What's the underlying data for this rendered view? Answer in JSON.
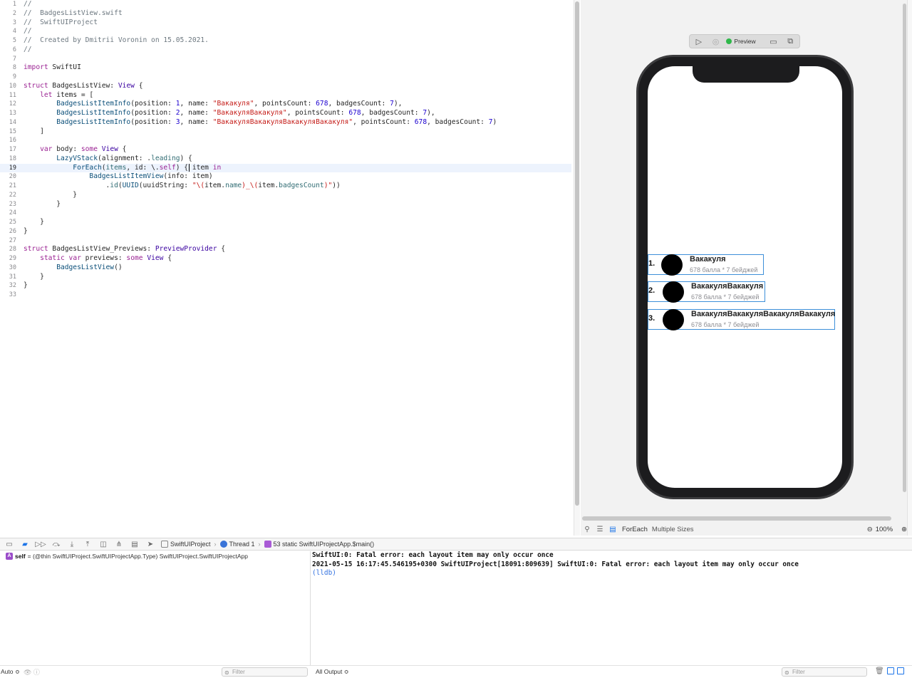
{
  "editor": {
    "current_line": 19,
    "lines": [
      {
        "n": "1",
        "tokens": [
          {
            "t": "//",
            "c": "comment"
          }
        ]
      },
      {
        "n": "2",
        "tokens": [
          {
            "t": "//  BadgesListView.swift",
            "c": "comment"
          }
        ]
      },
      {
        "n": "3",
        "tokens": [
          {
            "t": "//  SwiftUIProject",
            "c": "comment"
          }
        ]
      },
      {
        "n": "4",
        "tokens": [
          {
            "t": "//",
            "c": "comment"
          }
        ]
      },
      {
        "n": "5",
        "tokens": [
          {
            "t": "//  Created by Dmitrii Voronin on 15.05.2021.",
            "c": "comment"
          }
        ]
      },
      {
        "n": "6",
        "tokens": [
          {
            "t": "//",
            "c": "comment"
          }
        ]
      },
      {
        "n": "7",
        "tokens": []
      },
      {
        "n": "8",
        "tokens": [
          {
            "t": "import",
            "c": "keyword"
          },
          {
            "t": " SwiftUI",
            "c": "plain"
          }
        ]
      },
      {
        "n": "9",
        "tokens": []
      },
      {
        "n": "10",
        "tokens": [
          {
            "t": "struct",
            "c": "keyword"
          },
          {
            "t": " BadgesListView: ",
            "c": "plain"
          },
          {
            "t": "View",
            "c": "type"
          },
          {
            "t": " {",
            "c": "plain"
          }
        ]
      },
      {
        "n": "11",
        "tokens": [
          {
            "t": "    ",
            "c": "plain"
          },
          {
            "t": "let",
            "c": "keyword"
          },
          {
            "t": " items = [",
            "c": "plain"
          }
        ]
      },
      {
        "n": "12",
        "tokens": [
          {
            "t": "        BadgesListItemInfo",
            "c": "class"
          },
          {
            "t": "(position: ",
            "c": "plain"
          },
          {
            "t": "1",
            "c": "number"
          },
          {
            "t": ", name: ",
            "c": "plain"
          },
          {
            "t": "\"Вакакуля\"",
            "c": "string"
          },
          {
            "t": ", pointsCount: ",
            "c": "plain"
          },
          {
            "t": "678",
            "c": "number"
          },
          {
            "t": ", badgesCount: ",
            "c": "plain"
          },
          {
            "t": "7",
            "c": "number"
          },
          {
            "t": "),",
            "c": "plain"
          }
        ]
      },
      {
        "n": "13",
        "tokens": [
          {
            "t": "        BadgesListItemInfo",
            "c": "class"
          },
          {
            "t": "(position: ",
            "c": "plain"
          },
          {
            "t": "2",
            "c": "number"
          },
          {
            "t": ", name: ",
            "c": "plain"
          },
          {
            "t": "\"ВакакуляВакакуля\"",
            "c": "string"
          },
          {
            "t": ", pointsCount: ",
            "c": "plain"
          },
          {
            "t": "678",
            "c": "number"
          },
          {
            "t": ", badgesCount: ",
            "c": "plain"
          },
          {
            "t": "7",
            "c": "number"
          },
          {
            "t": "),",
            "c": "plain"
          }
        ]
      },
      {
        "n": "14",
        "tokens": [
          {
            "t": "        BadgesListItemInfo",
            "c": "class"
          },
          {
            "t": "(position: ",
            "c": "plain"
          },
          {
            "t": "3",
            "c": "number"
          },
          {
            "t": ", name: ",
            "c": "plain"
          },
          {
            "t": "\"ВакакуляВакакуляВакакуляВакакуля\"",
            "c": "string"
          },
          {
            "t": ", pointsCount: ",
            "c": "plain"
          },
          {
            "t": "678",
            "c": "number"
          },
          {
            "t": ", badgesCount: ",
            "c": "plain"
          },
          {
            "t": "7",
            "c": "number"
          },
          {
            "t": ")",
            "c": "plain"
          }
        ]
      },
      {
        "n": "15",
        "tokens": [
          {
            "t": "    ]",
            "c": "plain"
          }
        ]
      },
      {
        "n": "16",
        "tokens": []
      },
      {
        "n": "17",
        "tokens": [
          {
            "t": "    ",
            "c": "plain"
          },
          {
            "t": "var",
            "c": "keyword"
          },
          {
            "t": " body: ",
            "c": "plain"
          },
          {
            "t": "some",
            "c": "keyword"
          },
          {
            "t": " ",
            "c": "plain"
          },
          {
            "t": "View",
            "c": "type"
          },
          {
            "t": " {",
            "c": "plain"
          }
        ]
      },
      {
        "n": "18",
        "tokens": [
          {
            "t": "        LazyVStack",
            "c": "class"
          },
          {
            "t": "(alignment: .",
            "c": "plain"
          },
          {
            "t": "leading",
            "c": "func"
          },
          {
            "t": ") {",
            "c": "plain"
          }
        ]
      },
      {
        "n": "19",
        "tokens": [
          {
            "t": "            ForEach",
            "c": "class"
          },
          {
            "t": "(",
            "c": "plain"
          },
          {
            "t": "items",
            "c": "func"
          },
          {
            "t": ", id: \\.",
            "c": "plain"
          },
          {
            "t": "self",
            "c": "keyword"
          },
          {
            "t": ") { item ",
            "c": "plain"
          },
          {
            "t": "in",
            "c": "keyword"
          }
        ]
      },
      {
        "n": "20",
        "tokens": [
          {
            "t": "                BadgesListItemView",
            "c": "class"
          },
          {
            "t": "(info: item)",
            "c": "plain"
          }
        ]
      },
      {
        "n": "21",
        "tokens": [
          {
            "t": "                    .",
            "c": "plain"
          },
          {
            "t": "id",
            "c": "func"
          },
          {
            "t": "(",
            "c": "plain"
          },
          {
            "t": "UUID",
            "c": "class"
          },
          {
            "t": "(uuidString: ",
            "c": "plain"
          },
          {
            "t": "\"\\(",
            "c": "string"
          },
          {
            "t": "item.",
            "c": "plain"
          },
          {
            "t": "name",
            "c": "func"
          },
          {
            "t": ")_\\(",
            "c": "string"
          },
          {
            "t": "item.",
            "c": "plain"
          },
          {
            "t": "badgesCount",
            "c": "func"
          },
          {
            "t": ")\"",
            "c": "string"
          },
          {
            "t": "))",
            "c": "plain"
          }
        ]
      },
      {
        "n": "22",
        "tokens": [
          {
            "t": "            }",
            "c": "plain"
          }
        ]
      },
      {
        "n": "23",
        "tokens": [
          {
            "t": "        }",
            "c": "plain"
          }
        ]
      },
      {
        "n": "24",
        "tokens": []
      },
      {
        "n": "25",
        "tokens": [
          {
            "t": "    }",
            "c": "plain"
          }
        ]
      },
      {
        "n": "26",
        "tokens": [
          {
            "t": "}",
            "c": "plain"
          }
        ]
      },
      {
        "n": "27",
        "tokens": []
      },
      {
        "n": "28",
        "tokens": [
          {
            "t": "struct",
            "c": "keyword"
          },
          {
            "t": " BadgesListView_Previews: ",
            "c": "plain"
          },
          {
            "t": "PreviewProvider",
            "c": "type"
          },
          {
            "t": " {",
            "c": "plain"
          }
        ]
      },
      {
        "n": "29",
        "tokens": [
          {
            "t": "    ",
            "c": "plain"
          },
          {
            "t": "static",
            "c": "keyword"
          },
          {
            "t": " ",
            "c": "plain"
          },
          {
            "t": "var",
            "c": "keyword"
          },
          {
            "t": " previews: ",
            "c": "plain"
          },
          {
            "t": "some",
            "c": "keyword"
          },
          {
            "t": " ",
            "c": "plain"
          },
          {
            "t": "View",
            "c": "type"
          },
          {
            "t": " {",
            "c": "plain"
          }
        ]
      },
      {
        "n": "30",
        "tokens": [
          {
            "t": "        BadgesListView",
            "c": "class"
          },
          {
            "t": "()",
            "c": "plain"
          }
        ]
      },
      {
        "n": "31",
        "tokens": [
          {
            "t": "    }",
            "c": "plain"
          }
        ]
      },
      {
        "n": "32",
        "tokens": [
          {
            "t": "}",
            "c": "plain"
          }
        ]
      },
      {
        "n": "33",
        "tokens": []
      }
    ]
  },
  "preview": {
    "toolbar": {
      "live_icon": "play-circle-icon",
      "inspect_icon": "inspect-icon",
      "preview_label": "Preview",
      "device_icon": "device-icon",
      "duplicate_icon": "duplicate-icon",
      "status_color": "#2fb84a"
    },
    "rows": [
      {
        "position": "1.",
        "name": "Вакакуля",
        "subtitle": "678 балла * 7 бейджей"
      },
      {
        "position": "2.",
        "name": "ВакакуляВакакуля",
        "subtitle": "678 балла * 7 бейджей"
      },
      {
        "position": "3.",
        "name": "ВакакуляВакакуляВакакуляВакакуля",
        "subtitle": "678 балла * 7 бейджей"
      }
    ],
    "bottom": {
      "pin_icon": "pin-icon",
      "variants_icon": "adjust-icon",
      "component_name": "ForEach",
      "variant_label": "Multiple Sizes",
      "zoom_level": "100%"
    }
  },
  "debug_bar": {
    "project": "SwiftUIProject",
    "thread": "Thread 1",
    "frame": "53 static SwiftUIProjectApp.$main()"
  },
  "variables": {
    "badge": "A",
    "name": "self",
    "value": " = (@thin SwiftUIProject.SwiftUIProjectApp.Type) SwiftUIProject.SwiftUIProjectApp"
  },
  "console": {
    "lines": [
      "SwiftUI:0: Fatal error: each layout item may only occur once",
      "2021-05-15 16:17:45.546195+0300 SwiftUIProject[18091:809639] SwiftUI:0: Fatal error: each layout item may only occur once",
      "(lldb)"
    ]
  },
  "status": {
    "auto_label": "Auto ≎",
    "variables_filter_placeholder": "Filter",
    "output_label": "All Output ≎",
    "console_filter_placeholder": "Filter"
  },
  "colors": {
    "accent": "#1c74e8",
    "selection_outline": "#3d8fd9",
    "current_line": "#edf3fd"
  }
}
